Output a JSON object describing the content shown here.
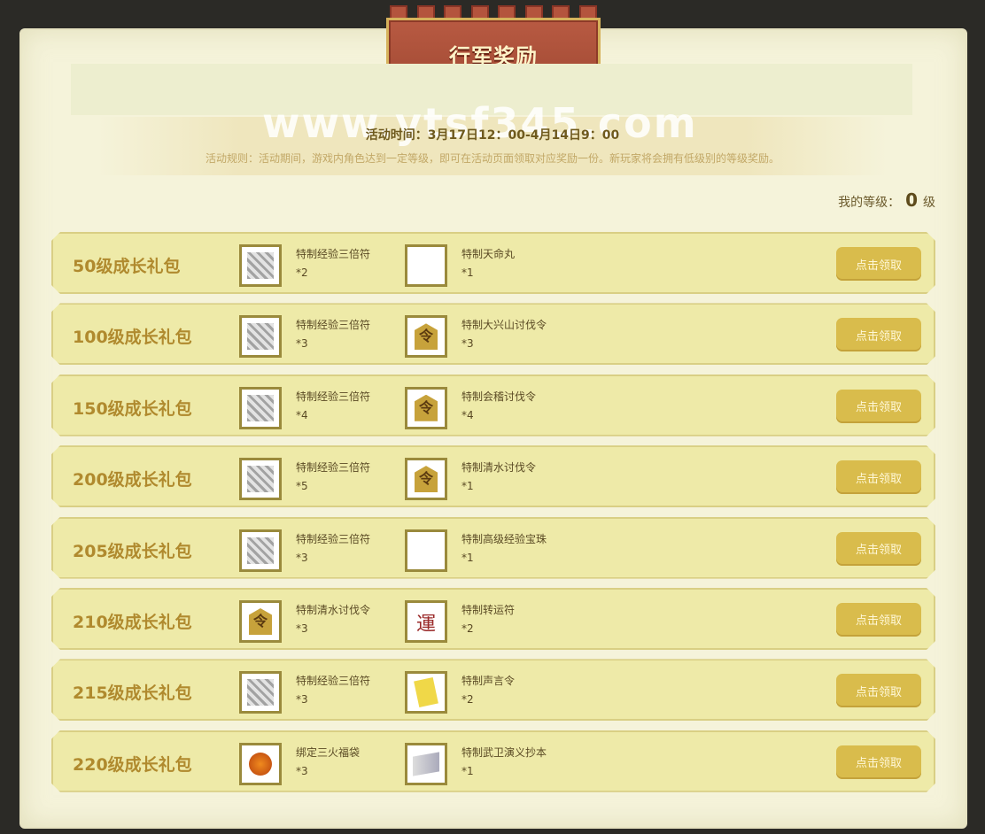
{
  "header": {
    "title": "行军奖励"
  },
  "watermark": "www.ytsf345.com",
  "event": {
    "time": "活动时间：3月17日12：00-4月14日9：00",
    "rules": "活动规则：活动期间，游戏内角色达到一定等级，即可在活动页面领取对应奖励一份。新玩家将会拥有低级别的等级奖励。"
  },
  "my_level": {
    "label": "我的等级：",
    "value": "0",
    "unit": "级"
  },
  "claim_label": "点击领取",
  "packs": [
    {
      "name": "50级成长礼包",
      "items": [
        {
          "name": "特制经验三倍符",
          "qty": "*2",
          "icon": "exp-scroll-icon"
        },
        {
          "name": "特制天命丸",
          "qty": "*1",
          "icon": "eye-pill-icon"
        }
      ]
    },
    {
      "name": "100级成长礼包",
      "items": [
        {
          "name": "特制经验三倍符",
          "qty": "*3",
          "icon": "exp-scroll-icon"
        },
        {
          "name": "特制大兴山讨伐令",
          "qty": "*3",
          "icon": "token-icon"
        }
      ]
    },
    {
      "name": "150级成长礼包",
      "items": [
        {
          "name": "特制经验三倍符",
          "qty": "*4",
          "icon": "exp-scroll-icon"
        },
        {
          "name": "特制会稽讨伐令",
          "qty": "*4",
          "icon": "token-icon"
        }
      ]
    },
    {
      "name": "200级成长礼包",
      "items": [
        {
          "name": "特制经验三倍符",
          "qty": "*5",
          "icon": "exp-scroll-icon"
        },
        {
          "name": "特制清水讨伐令",
          "qty": "*1",
          "icon": "token-icon"
        }
      ]
    },
    {
      "name": "205级成长礼包",
      "items": [
        {
          "name": "特制经验三倍符",
          "qty": "*3",
          "icon": "exp-scroll-icon"
        },
        {
          "name": "特制高级经验宝珠",
          "qty": "*1",
          "icon": "exp-orb-icon"
        }
      ]
    },
    {
      "name": "210级成长礼包",
      "items": [
        {
          "name": "特制清水讨伐令",
          "qty": "*3",
          "icon": "token-icon"
        },
        {
          "name": "特制转运符",
          "qty": "*2",
          "icon": "luck-charm-icon"
        }
      ]
    },
    {
      "name": "215级成长礼包",
      "items": [
        {
          "name": "特制经验三倍符",
          "qty": "*3",
          "icon": "exp-scroll-icon"
        },
        {
          "name": "特制声言令",
          "qty": "*2",
          "icon": "voice-order-icon"
        }
      ]
    },
    {
      "name": "220级成长礼包",
      "items": [
        {
          "name": "绑定三火福袋",
          "qty": "*3",
          "icon": "lucky-bag-icon"
        },
        {
          "name": "特制武卫演义抄本",
          "qty": "*1",
          "icon": "book-icon"
        }
      ]
    }
  ]
}
